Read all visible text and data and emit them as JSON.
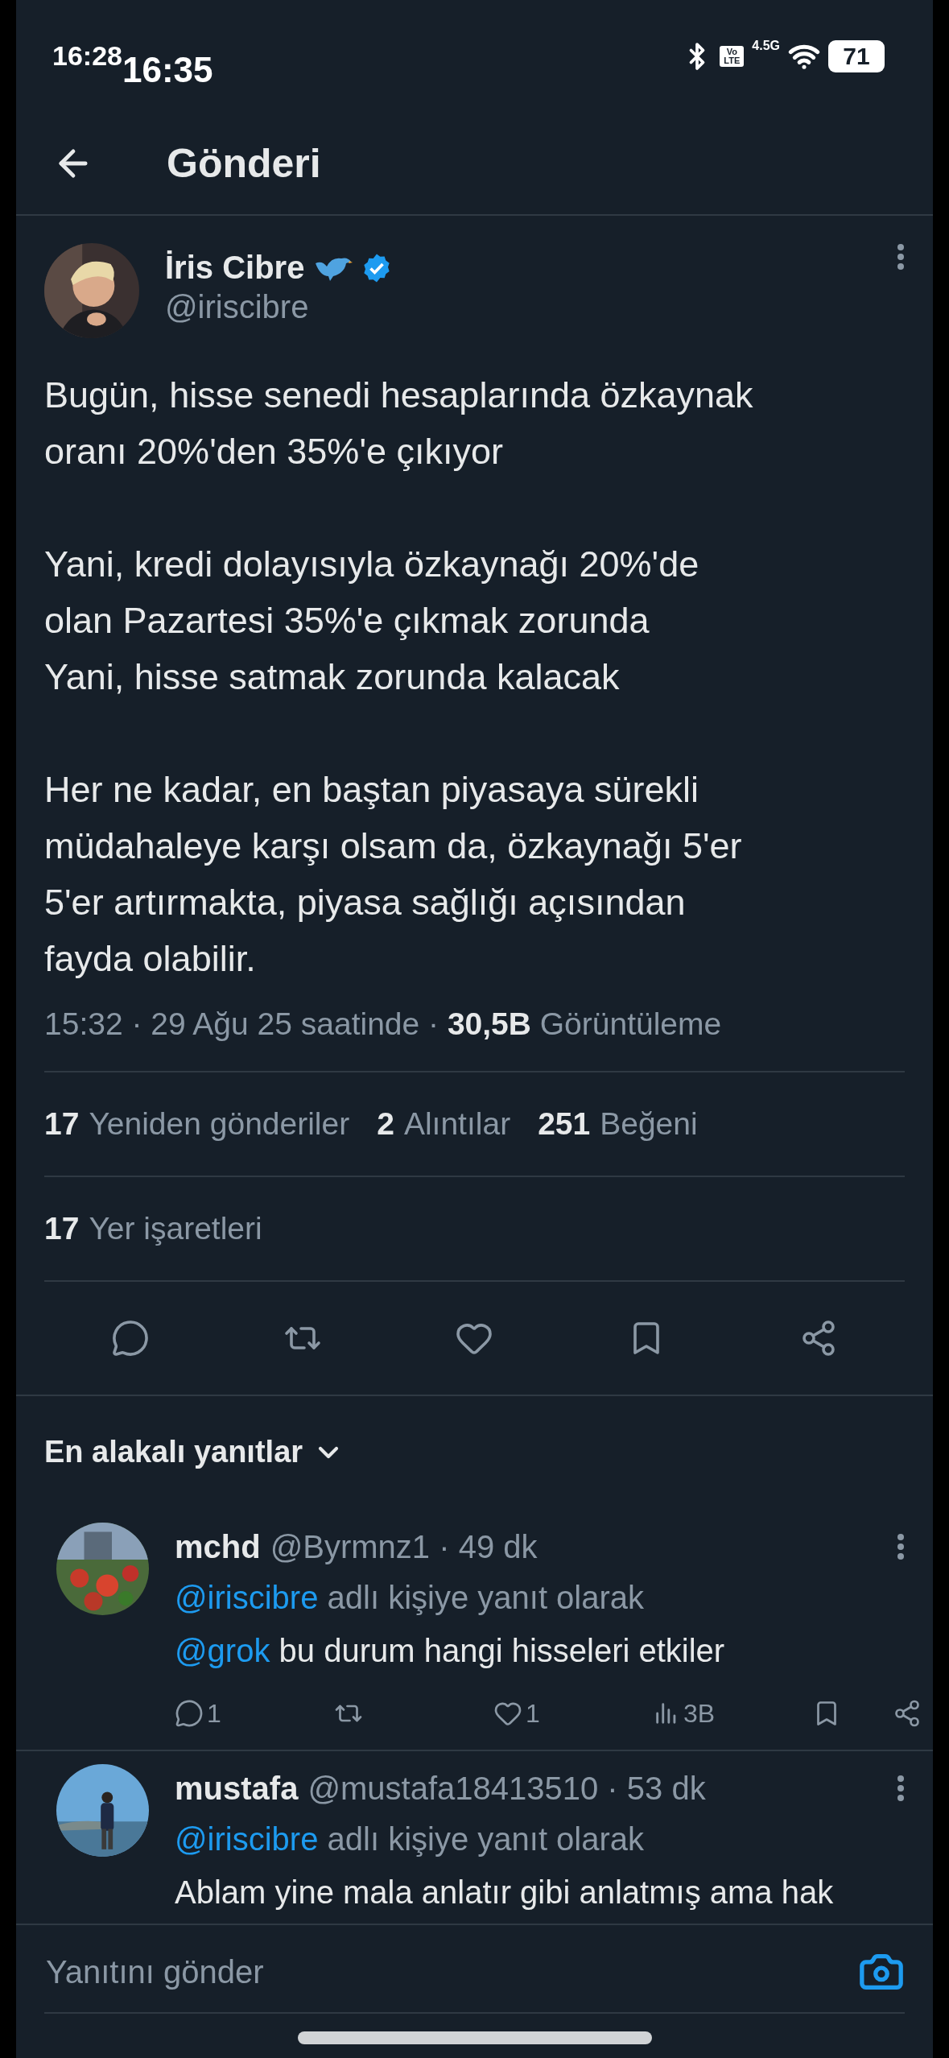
{
  "status_bar": {
    "times": [
      "16:28",
      "16:35"
    ],
    "volte": "Vo LTE",
    "network": "4.5G",
    "battery": "71"
  },
  "header": {
    "title": "Gönderi"
  },
  "post": {
    "author": {
      "name": "İris Cibre",
      "handle": "@iriscibre",
      "verified": true
    },
    "paragraphs": [
      [
        "Bugün, hisse senedi hesaplarında özkaynak",
        "oranı 20%'den 35%'e çıkıyor"
      ],
      [
        "Yani, kredi dolayısıyla özkaynağı 20%'de",
        "olan Pazartesi 35%'e çıkmak zorunda",
        "Yani, hisse satmak zorunda kalacak"
      ],
      [
        "Her ne kadar, en baştan piyasaya sürekli",
        "müdahaleye karşı olsam da, özkaynağı 5'er",
        "5'er artırmakta, piyasa sağlığı açısından",
        "fayda olabilir."
      ]
    ],
    "meta": "15:32 · 29 Ağu 25 saatinde · **30,5B** Görüntüleme",
    "stats": [
      {
        "count": "17",
        "label": "Yeniden gönderiler"
      },
      {
        "count": "2",
        "label": "Alıntılar"
      },
      {
        "count": "251",
        "label": "Beğeni"
      }
    ],
    "bookmarks": {
      "count": "17",
      "label": "Yer işaretleri"
    },
    "actions": [
      {
        "kind": "reply"
      },
      {
        "kind": "repost"
      },
      {
        "kind": "like"
      },
      {
        "kind": "bookmark"
      },
      {
        "kind": "share"
      }
    ]
  },
  "replies_header": {
    "label": "En alakalı yanıtlar"
  },
  "replies": [
    {
      "name": "mchd",
      "handle_time": "@Byrmnz1 · 49 dk",
      "reply_to": {
        "mention": "@iriscibre",
        "text": "adlı kişiye yanıt olarak"
      },
      "body": {
        "mention": "@grok",
        "text": "bu durum hangi hisseleri etkiler"
      },
      "actions": [
        {
          "kind": "reply",
          "count": "1"
        },
        {
          "kind": "repost"
        },
        {
          "kind": "like",
          "count": "1"
        },
        {
          "kind": "views",
          "count": "3B"
        },
        {
          "kind": "bookmark"
        },
        {
          "kind": "share"
        }
      ]
    },
    {
      "name": "mustafa",
      "handle_time": "@mustafa18413510 · 53 dk",
      "reply_to": {
        "mention": "@iriscibre",
        "text": "adlı kişiye yanıt olarak"
      },
      "body": {
        "text": "Ablam yine mala anlatır gibi anlatmış ama hak"
      }
    }
  ],
  "composer": {
    "placeholder": "Yanıtını gönder"
  }
}
